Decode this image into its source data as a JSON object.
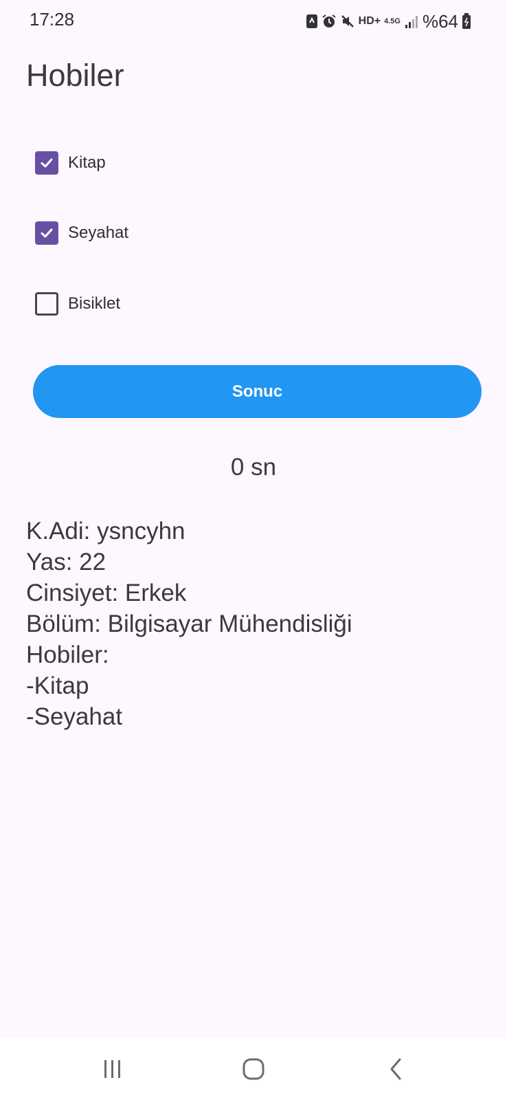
{
  "status_bar": {
    "time": "17:28",
    "network": "4.5G",
    "hd": "HD+",
    "battery": "%64"
  },
  "page": {
    "title": "Hobiler"
  },
  "hobbies": [
    {
      "label": "Kitap",
      "checked": true
    },
    {
      "label": "Seyahat",
      "checked": true
    },
    {
      "label": "Bisiklet",
      "checked": false
    }
  ],
  "button": {
    "label": "Sonuc",
    "color": "#2196f3"
  },
  "timer": {
    "text": "0 sn"
  },
  "summary": {
    "lines": [
      "K.Adi: ysncyhn",
      "Yas: 22",
      "Cinsiyet: Erkek",
      "Bölüm: Bilgisayar Mühendisliği",
      "Hobiler:",
      "-Kitap",
      "-Seyahat"
    ]
  },
  "colors": {
    "background": "#fdf7ff",
    "checkbox_accent": "#6750a4"
  },
  "nav_icons": [
    "recent-apps-icon",
    "home-icon",
    "back-icon"
  ]
}
